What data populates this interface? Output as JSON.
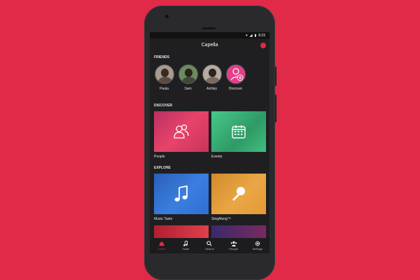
{
  "status_bar": {
    "time": "8:23"
  },
  "app": {
    "title": "Capella"
  },
  "friends": {
    "section_title": "FRIENDS",
    "items": [
      {
        "name": "Paula"
      },
      {
        "name": "Sam"
      },
      {
        "name": "Ashley"
      },
      {
        "name": "Discover"
      }
    ]
  },
  "discover": {
    "section_title": "DISCOVER",
    "tiles": [
      {
        "label": "People",
        "icon": "people-icon"
      },
      {
        "label": "Events",
        "icon": "calendar-icon"
      }
    ]
  },
  "explore": {
    "section_title": "EXPLORE",
    "tiles": [
      {
        "label": "Music Taste",
        "icon": "music-note-icon"
      },
      {
        "label": "SingAlong™",
        "icon": "microphone-icon"
      }
    ]
  },
  "nav": {
    "items": [
      {
        "label": "Home",
        "icon": "home-icon",
        "active": true
      },
      {
        "label": "Taste",
        "icon": "music-note-icon"
      },
      {
        "label": "Search",
        "icon": "search-icon"
      },
      {
        "label": "People",
        "icon": "people-icon"
      },
      {
        "label": "Settings",
        "icon": "gear-icon"
      }
    ]
  },
  "colors": {
    "background": "#e02a48",
    "accent": "#e02a48",
    "people_tile": "#e03d62",
    "events_tile": "#3fbf7f",
    "music_tile": "#2f6fd1",
    "singalong_tile": "#e29a36"
  }
}
